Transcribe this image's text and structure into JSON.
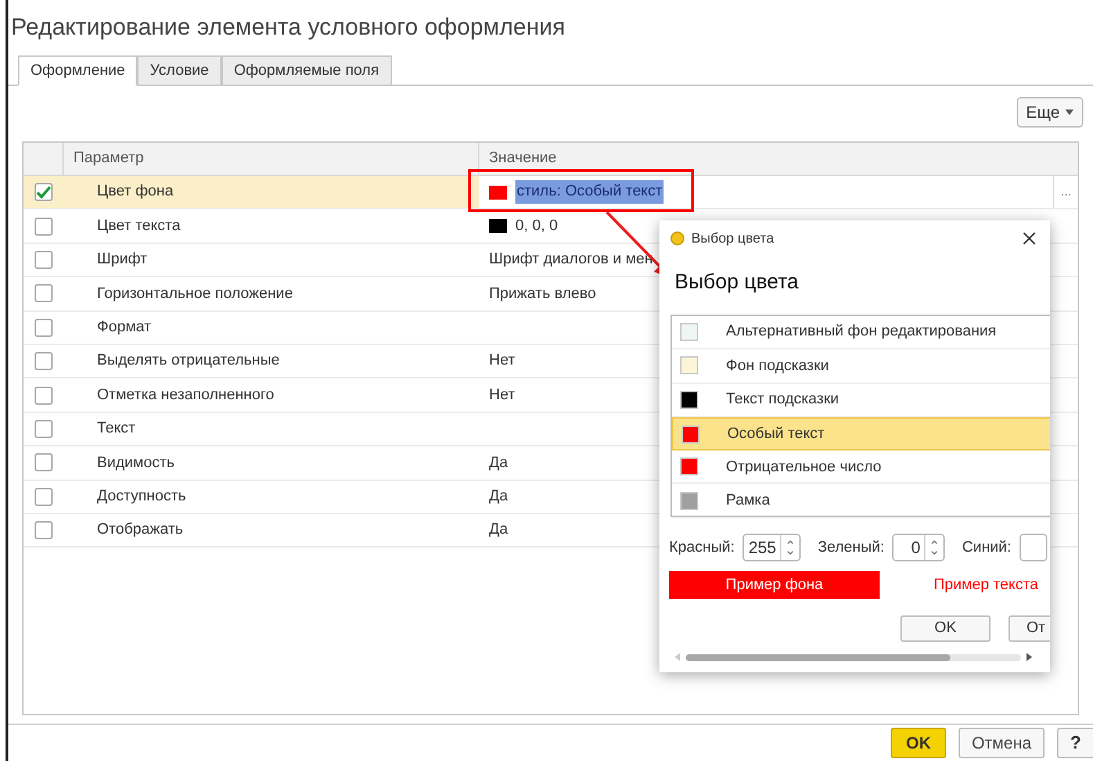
{
  "window": {
    "title": "Редактирование элемента условного оформления"
  },
  "tabs": [
    {
      "label": "Оформление",
      "selected": true
    },
    {
      "label": "Условие",
      "selected": false
    },
    {
      "label": "Оформляемые поля",
      "selected": false
    }
  ],
  "more_button": "Еще",
  "ellipsis_button": "...",
  "table": {
    "columns": [
      "Параметр",
      "Значение"
    ],
    "rows": [
      {
        "checked": true,
        "selected": true,
        "parameter": "Цвет фона",
        "kind": "color",
        "color": "#ff0000",
        "value": "стиль: Особый текст",
        "value_selected": true
      },
      {
        "checked": false,
        "selected": false,
        "parameter": "Цвет текста",
        "kind": "color",
        "color": "#000000",
        "value": "0, 0, 0",
        "value_selected": false
      },
      {
        "checked": false,
        "selected": false,
        "parameter": "Шрифт",
        "kind": "text",
        "value": "Шрифт диалогов и мен"
      },
      {
        "checked": false,
        "selected": false,
        "parameter": "Горизонтальное положение",
        "kind": "text",
        "value": "Прижать влево"
      },
      {
        "checked": false,
        "selected": false,
        "parameter": "Формат",
        "kind": "text"
      },
      {
        "checked": false,
        "selected": false,
        "parameter": "Выделять отрицательные",
        "kind": "text",
        "value": "Нет"
      },
      {
        "checked": false,
        "selected": false,
        "parameter": "Отметка незаполненного",
        "kind": "text",
        "value": "Нет"
      },
      {
        "checked": false,
        "selected": false,
        "parameter": "Текст",
        "kind": "text"
      },
      {
        "checked": false,
        "selected": false,
        "parameter": "Видимость",
        "kind": "text",
        "value": "Да"
      },
      {
        "checked": false,
        "selected": false,
        "parameter": "Доступность",
        "kind": "text",
        "value": "Да"
      },
      {
        "checked": false,
        "selected": false,
        "parameter": "Отображать",
        "kind": "text",
        "value": "Да"
      }
    ]
  },
  "color_dialog": {
    "title": "Выбор цвета",
    "heading": "Выбор цвета",
    "colors": [
      {
        "name": "Альтернативный фон редактирования",
        "color": "#f0f7f2",
        "selected": false
      },
      {
        "name": "Фон подсказки",
        "color": "#fdf5d8",
        "selected": false
      },
      {
        "name": "Текст подсказки",
        "color": "#000000",
        "selected": false
      },
      {
        "name": "Особый текст",
        "color": "#ff0000",
        "selected": true
      },
      {
        "name": "Отрицательное число",
        "color": "#ff0000",
        "selected": false
      },
      {
        "name": "Рамка",
        "color": "#a0a0a0",
        "selected": false
      }
    ],
    "red": {
      "label": "Красный:",
      "value": "255"
    },
    "green": {
      "label": "Зеленый:",
      "value": "0"
    },
    "blue": {
      "label": "Синий:"
    },
    "background_sample": "Пример фона",
    "text_sample": "Пример текста",
    "ok": "OK",
    "cancel": "От"
  },
  "footer": {
    "ok": "OK",
    "cancel": "Отмена",
    "help": "?"
  }
}
